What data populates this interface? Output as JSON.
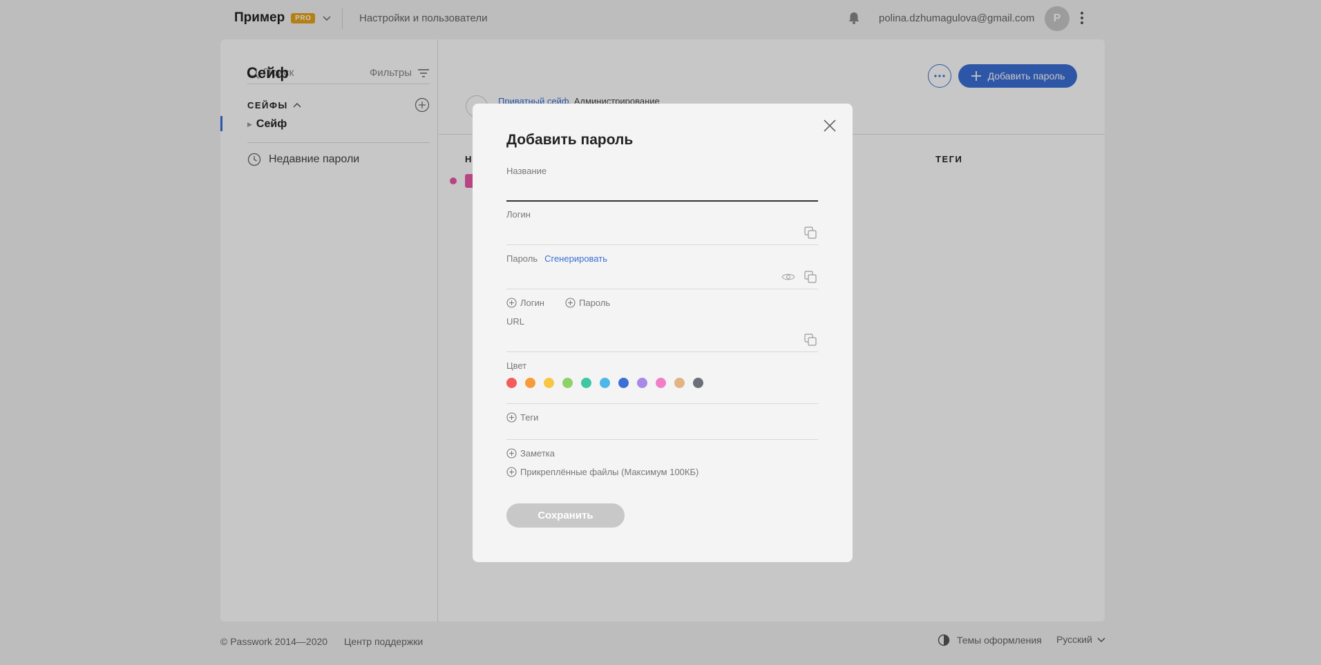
{
  "topbar": {
    "brand": "Пример",
    "pro_badge": "PRO",
    "settings_link": "Настройки и пользователи",
    "user_email": "polina.dzhumagulova@gmail.com",
    "avatar_letter": "P"
  },
  "sidebar": {
    "search_placeholder": "Поиск",
    "filters_label": "Фильтры",
    "vaults_title": "СЕЙФЫ",
    "vault_item": "Сейф",
    "recent_label": "Недавние пароли"
  },
  "content": {
    "title": "Сейф",
    "add_password_button": "Добавить пароль",
    "vault_private": "Приватный сейф.",
    "vault_role": "Администрирование",
    "col_name": "Н",
    "col_tags": "ТЕГИ",
    "row_color": "#e95aa7"
  },
  "footer": {
    "copyright": "© Passwork 2014—2020",
    "support": "Центр поддержки",
    "themes": "Темы оформления",
    "language": "Русский"
  },
  "modal": {
    "title": "Добавить пароль",
    "name_label": "Название",
    "name_value": "",
    "login_label": "Логин",
    "login_value": "",
    "password_label": "Пароль",
    "generate_link": "Сгенерировать",
    "password_value": "",
    "add_login": "Логин",
    "add_password": "Пароль",
    "url_label": "URL",
    "url_value": "",
    "color_label": "Цвет",
    "colors": [
      "#f45b5b",
      "#f79a3a",
      "#f7c744",
      "#8fd068",
      "#3dc7a3",
      "#4db8e8",
      "#3b6fd6",
      "#a88ae6",
      "#f07fc8",
      "#e2b385",
      "#6b7078"
    ],
    "tags_label": "Теги",
    "note_label": "Заметка",
    "attachments_label": "Прикреплённые файлы (Максимум 100КБ)",
    "save_button": "Сохранить"
  },
  "accent_color": "#3b6fd6"
}
